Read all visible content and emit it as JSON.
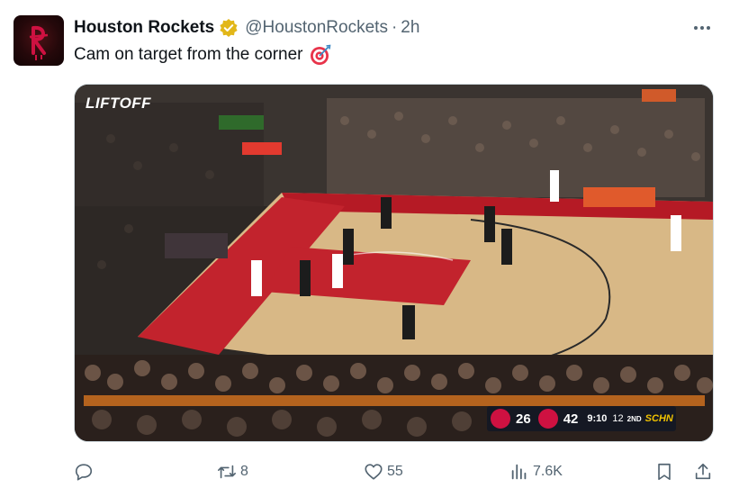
{
  "tweet": {
    "display_name": "Houston Rockets",
    "handle": "@HoustonRockets",
    "separator": "·",
    "time": "2h",
    "text": "Cam on target from the corner",
    "text_emoji": "direct-hit-emoji",
    "verified_badge": "gold-verified-badge-icon",
    "more_icon": "more-options-icon"
  },
  "media": {
    "watermark": "LIFTOFF",
    "scorebug": {
      "home_score": "26",
      "away_score": "42",
      "clock": "9:10",
      "shot_clock": "12",
      "period": "2ND",
      "network": "SCHN"
    }
  },
  "actions": {
    "reply_count": "",
    "retweet_count": "8",
    "like_count": "55",
    "views_count": "7.6K"
  },
  "colors": {
    "text_primary": "#0f1419",
    "text_secondary": "#536471",
    "verified_gold": "#e2b719",
    "rockets_red": "#ce1141"
  }
}
